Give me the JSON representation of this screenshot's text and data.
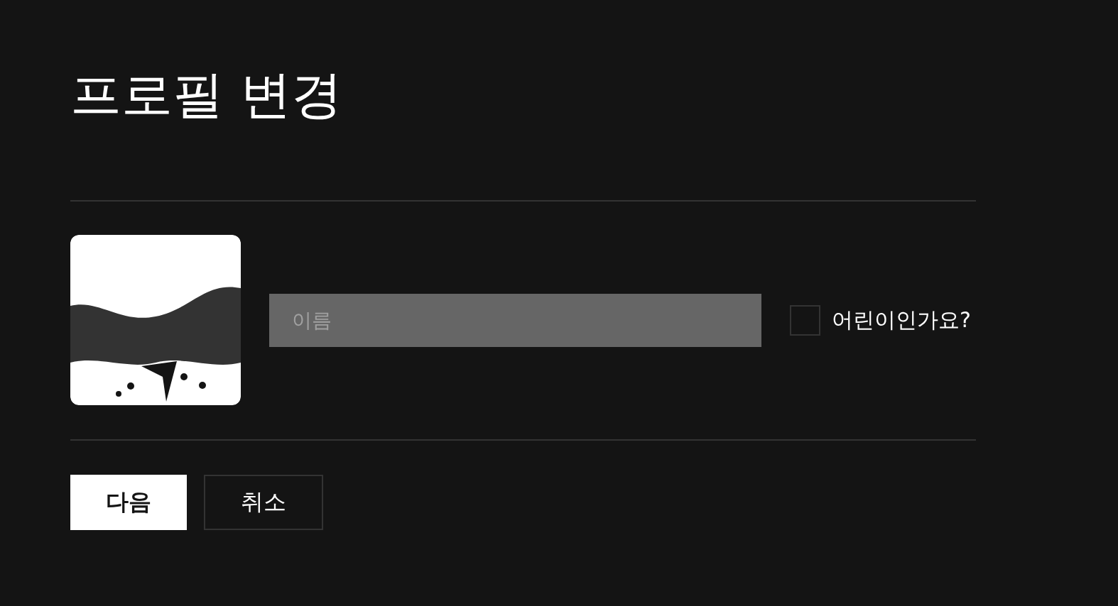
{
  "title": "프로필 변경",
  "name_field": {
    "placeholder": "이름"
  },
  "kids_checkbox": {
    "label": "어린이인가요?",
    "checked": false
  },
  "buttons": [
    {
      "label": "다음",
      "kind": "primary"
    },
    {
      "label": "취소",
      "kind": "secondary"
    }
  ]
}
